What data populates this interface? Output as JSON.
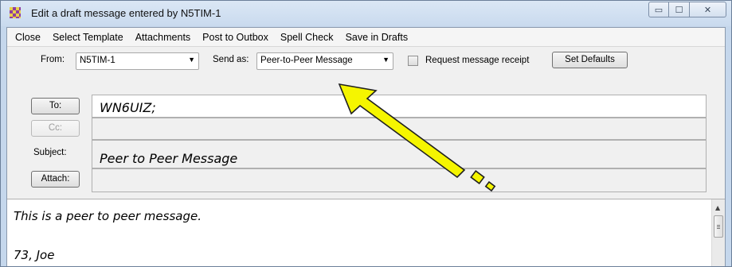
{
  "window": {
    "title": "Edit a draft message entered by N5TIM-1"
  },
  "title_buttons": {
    "minimize_glyph": "▭",
    "maximize_glyph": "☐",
    "close_glyph": "✕"
  },
  "menu": {
    "items": [
      "Close",
      "Select Template",
      "Attachments",
      "Post to Outbox",
      "Spell Check",
      "Save in Drafts"
    ]
  },
  "from_row": {
    "from_label": "From:",
    "from_value": "N5TIM-1",
    "send_as_label": "Send as:",
    "send_as_value": "Peer-to-Peer Message",
    "receipt_label": "Request message receipt",
    "receipt_checked": false,
    "set_defaults_label": "Set Defaults"
  },
  "address": {
    "to_button": "To:",
    "to_value": "WN6UIZ;",
    "cc_button": "Cc:",
    "cc_value": "",
    "subject_label": "Subject:",
    "subject_value": "Peer to Peer Message",
    "attach_button": "Attach:",
    "attach_value": ""
  },
  "message_body": {
    "lines": [
      "This is a peer to peer message.",
      "",
      "73, Joe"
    ]
  },
  "colors": {
    "callout_arrow_fill": "#f5f500",
    "window_frame": "#c5d7ec",
    "client_background": "#f0f0f0"
  }
}
